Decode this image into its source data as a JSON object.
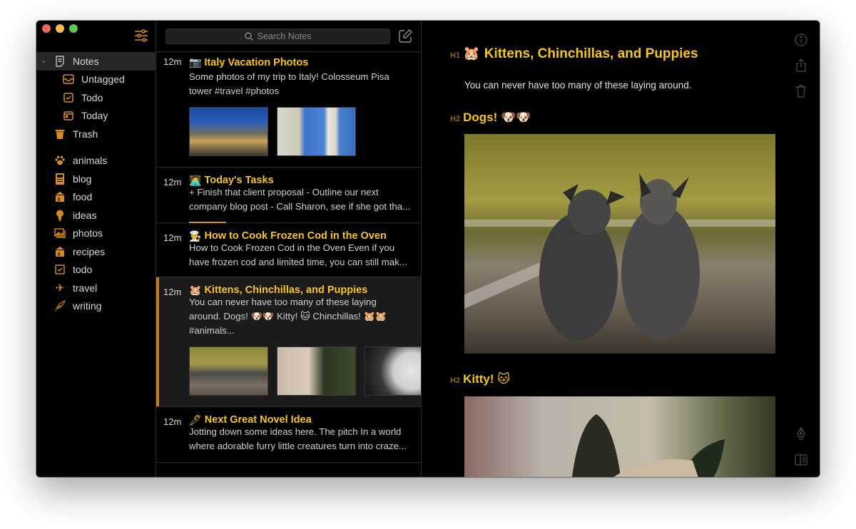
{
  "window": {
    "traffic_lights": [
      "close",
      "minimize",
      "maximize"
    ]
  },
  "sidebar": {
    "filter_icon": "sliders-icon",
    "items": [
      {
        "label": "Notes",
        "icon": "note-icon",
        "selected": true,
        "expanded": true
      },
      {
        "label": "Untagged",
        "icon": "inbox-icon"
      },
      {
        "label": "Todo",
        "icon": "checkbox-icon"
      },
      {
        "label": "Today",
        "icon": "calendar-icon"
      },
      {
        "label": "Trash",
        "icon": "trash-icon"
      }
    ],
    "tags": [
      {
        "label": "animals",
        "icon": "paw-icon"
      },
      {
        "label": "blog",
        "icon": "newspaper-icon"
      },
      {
        "label": "food",
        "icon": "pot-icon"
      },
      {
        "label": "ideas",
        "icon": "lightbulb-icon"
      },
      {
        "label": "photos",
        "icon": "photos-icon"
      },
      {
        "label": "recipes",
        "icon": "pot-icon"
      },
      {
        "label": "todo",
        "icon": "checkbox-icon"
      },
      {
        "label": "travel",
        "icon": "airplane-icon"
      },
      {
        "label": "writing",
        "icon": "quill-icon"
      }
    ]
  },
  "notelist": {
    "search_placeholder": "Search Notes",
    "notes": [
      {
        "time": "12m",
        "emoji": "📷",
        "title": "Italy Vacation Photos",
        "preview": "Some photos of my trip to Italy! Colosseum Pisa tower #travel #photos",
        "thumbnails": [
          "Colosseum photo",
          "Pisa tower photo"
        ]
      },
      {
        "time": "12m",
        "emoji": "👩‍💻",
        "title": "Today's Tasks",
        "preview": "+ Finish that client proposal - Outline our next company blog post - Call Sharon, see if she got tha...",
        "progress": 0.2
      },
      {
        "time": "12m",
        "emoji": "👨‍🍳",
        "title": "How to Cook Frozen Cod in the Oven",
        "preview": "How to Cook Frozen Cod in the Oven Even if you have frozen cod and limited time, you can still mak..."
      },
      {
        "time": "12m",
        "emoji": "🐹",
        "title": "Kittens, Chinchillas, and Puppies",
        "preview": "You can never have too many of these laying around. Dogs! 🐶🐶 Kitty! 🐱 Chinchillas! 🐹🐹 #animals...",
        "selected": true,
        "thumbnails": [
          "Dogs photo",
          "Kitten photo",
          "Chinchilla photo"
        ]
      },
      {
        "time": "12m",
        "emoji": "🖊",
        "title": "Next Great Novel Idea",
        "preview": "Jotting down some ideas here. The pitch In a world where adorable furry little creatures turn into craze..."
      }
    ]
  },
  "editor": {
    "h1_marker": "H1",
    "h1_emoji": "🐹",
    "h1": "Kittens, Chinchillas, and Puppies",
    "paragraph": "You can never have too many of these laying around.",
    "h2_dogs_marker": "H2",
    "h2_dogs": "Dogs! 🐶🐶",
    "h2_kitty_marker": "H2",
    "h2_kitty": "Kitty! 🐱",
    "tools_top": [
      "info-icon",
      "share-icon",
      "trash-icon"
    ],
    "tools_bottom": [
      "pen-icon",
      "sidebar-toggle-icon"
    ]
  },
  "colors": {
    "accent": "#d98a1e",
    "title": "#f6c521",
    "background": "#000000",
    "selected_row": "#1b1b1b"
  }
}
